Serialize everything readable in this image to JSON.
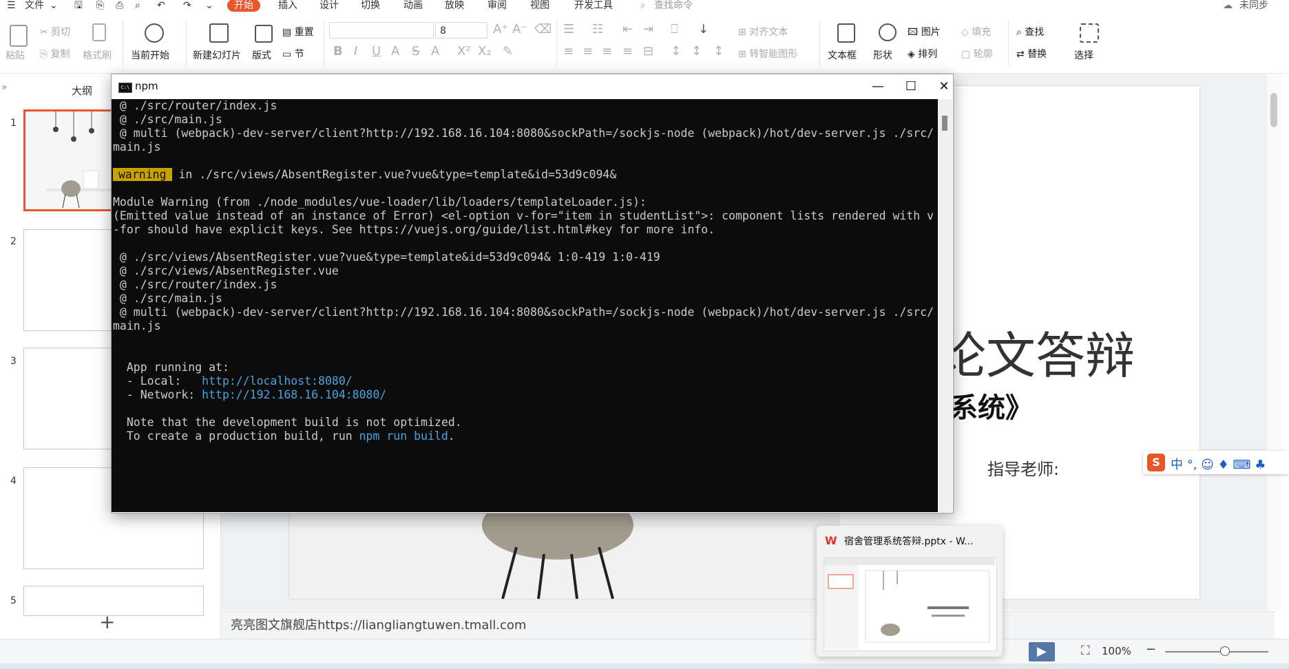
{
  "menu": {
    "file": "文件",
    "tabs": [
      "开始",
      "插入",
      "设计",
      "切换",
      "动画",
      "放映",
      "审阅",
      "视图",
      "开发工具"
    ],
    "search": "查找命令",
    "sync": "未同步"
  },
  "ribbon": {
    "paste": "粘贴",
    "cut": "剪切",
    "copy": "复制",
    "format_painter": "格式刷",
    "play_from_current": "当前开始",
    "new_slide": "新建幻灯片",
    "layout": "版式",
    "reset": "重置",
    "section": "节",
    "font_size": "8",
    "align_text": "对齐文本",
    "smart_shape": "转智能图形",
    "textbox": "文本框",
    "shape": "形状",
    "arrange": "排列",
    "picture": "图片",
    "fill": "填充",
    "outline": "轮廓",
    "find": "查找",
    "replace": "替换",
    "select": "选择"
  },
  "left_panel": {
    "outline_tab": "大纲",
    "slide_numbers": [
      "1",
      "2",
      "3",
      "4",
      "5"
    ],
    "add_symbol": "+"
  },
  "slide": {
    "title_partial": "论文答辩",
    "subtitle_partial": "系统》",
    "teacher_label": "指导老师:"
  },
  "notes": "亮亮图文旗舰店https://liangliangtuwen.tmall.com",
  "status": {
    "zoom": "100%"
  },
  "terminal": {
    "title": "npm",
    "lines": [
      " @ ./src/router/index.js",
      " @ ./src/main.js",
      " @ multi (webpack)-dev-server/client?http://192.168.16.104:8080&sockPath=/sockjs-node (webpack)/hot/dev-server.js ./src/",
      "main.js",
      "",
      "",
      "",
      "Module Warning (from ./node_modules/vue-loader/lib/loaders/templateLoader.js):",
      "(Emitted value instead of an instance of Error) <el-option v-for=\"item in studentList\">: component lists rendered with v",
      "-for should have explicit keys. See https://vuejs.org/guide/list.html#key for more info.",
      "",
      " @ ./src/views/AbsentRegister.vue?vue&type=template&id=53d9c094& 1:0-419 1:0-419",
      " @ ./src/views/AbsentRegister.vue",
      " @ ./src/router/index.js",
      " @ ./src/main.js",
      " @ multi (webpack)-dev-server/client?http://192.168.16.104:8080&sockPath=/sockjs-node (webpack)/hot/dev-server.js ./src/",
      "main.js",
      "",
      "",
      "",
      "  App running at:",
      "",
      "",
      "",
      "  Note that the development build is not optimized.",
      "  To create a production build, run "
    ],
    "warning_badge": "warning",
    "warning_text": " in ./src/views/AbsentRegister.vue?vue&type=template&id=53d9c094&",
    "local_label": "  - Local:   ",
    "local_url": "http://localhost:8080/",
    "network_label": "  - Network: ",
    "network_url": "http://192.168.16.104:8080/",
    "build_cmd": "npm run build",
    "build_end": "."
  },
  "taskbar_preview": {
    "title": "宿舍管理系统答辩.pptx - W..."
  },
  "ime": {
    "text": "中 °, ☺ ♦ ⌨ ♣"
  },
  "colors": {
    "accent": "#e8562a",
    "terminal_bg": "#0c0c0c",
    "warning_bg": "#c8a200",
    "link": "#4aa3df"
  }
}
